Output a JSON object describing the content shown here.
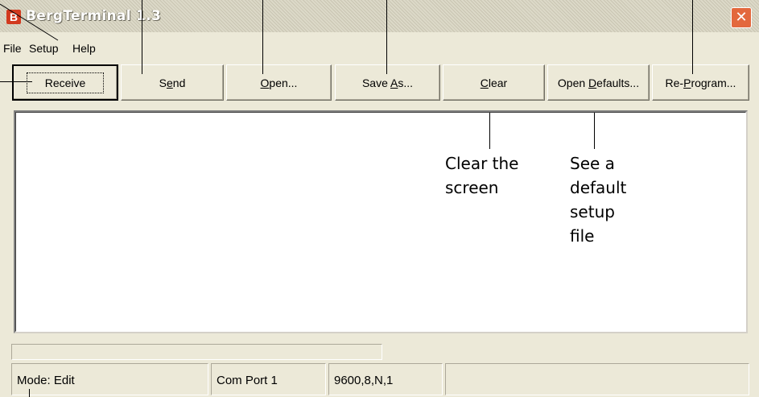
{
  "window": {
    "title": "BergTerminal 1.3",
    "icon_letter": "B"
  },
  "menu": [
    "File",
    "Setup",
    "Help"
  ],
  "toolbar": {
    "receive": "Receive",
    "send_pre": "S",
    "send_u": "e",
    "send_post": "nd",
    "open_u": "O",
    "open_post": "pen...",
    "saveas_pre": "Save ",
    "saveas_u": "A",
    "saveas_post": "s...",
    "clear_u": "C",
    "clear_post": "lear",
    "defaults_pre": "Open ",
    "defaults_u": "D",
    "defaults_post": "efaults...",
    "reprog_pre": "Re-",
    "reprog_u": "P",
    "reprog_post": "rogram..."
  },
  "status": {
    "mode": "Mode: Edit",
    "port": "Com Port 1",
    "settings": "9600,8,N,1",
    "extra": ""
  },
  "annotations": {
    "clear_line1": "Clear the",
    "clear_line2": "screen",
    "defaults_line1": "See a",
    "defaults_line2": "default",
    "defaults_line3": "setup",
    "defaults_line4": "file"
  }
}
